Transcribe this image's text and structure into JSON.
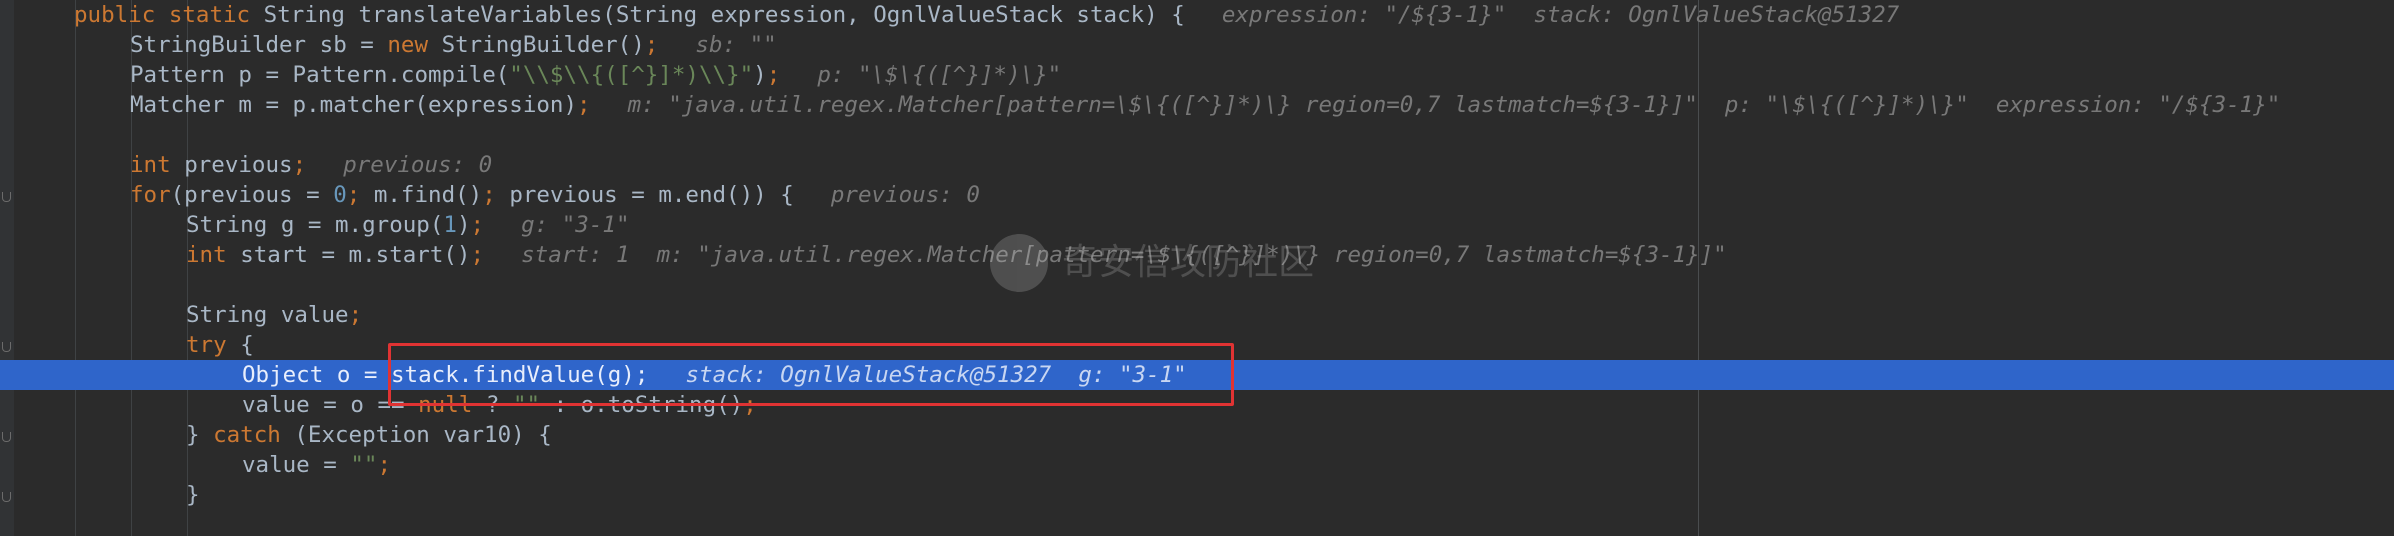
{
  "editor": {
    "lines": [
      {
        "indent": 1,
        "tokens": [
          {
            "t": "kw",
            "v": "public static "
          },
          {
            "t": "text",
            "v": "String translateVariables(String expression, OgnlValueStack stack) {"
          }
        ],
        "hint": "expression: \"/${3-1}\"  stack: OgnlValueStack@51327"
      },
      {
        "indent": 2,
        "tokens": [
          {
            "t": "text",
            "v": "StringBuilder sb = "
          },
          {
            "t": "kw",
            "v": "new "
          },
          {
            "t": "text",
            "v": "StringBuilder()"
          },
          {
            "t": "kw",
            "v": ";"
          }
        ],
        "hint": "sb: \"\""
      },
      {
        "indent": 2,
        "tokens": [
          {
            "t": "text",
            "v": "Pattern p = Pattern.compile("
          },
          {
            "t": "str",
            "v": "\"\\\\$\\\\{([^}]*)\\\\}\""
          },
          {
            "t": "text",
            "v": ")"
          },
          {
            "t": "kw",
            "v": ";"
          }
        ],
        "hint": "p: \"\\$\\{([^}]*)\\}\""
      },
      {
        "indent": 2,
        "tokens": [
          {
            "t": "text",
            "v": "Matcher m = p.matcher(expression)"
          },
          {
            "t": "kw",
            "v": ";"
          }
        ],
        "hint": "m: \"java.util.regex.Matcher[pattern=\\$\\{([^}]*)\\} region=0,7 lastmatch=${3-1}]\"  p: \"\\$\\{([^}]*)\\}\"  expression: \"/${3-1}\""
      },
      {
        "indent": 0,
        "tokens": [],
        "hint": ""
      },
      {
        "indent": 2,
        "tokens": [
          {
            "t": "kw",
            "v": "int "
          },
          {
            "t": "text",
            "v": "previous"
          },
          {
            "t": "kw",
            "v": ";"
          }
        ],
        "hint": "previous: 0"
      },
      {
        "indent": 2,
        "tokens": [
          {
            "t": "kw",
            "v": "for"
          },
          {
            "t": "text",
            "v": "(previous = "
          },
          {
            "t": "num",
            "v": "0"
          },
          {
            "t": "kw",
            "v": "; "
          },
          {
            "t": "text",
            "v": "m.find()"
          },
          {
            "t": "kw",
            "v": "; "
          },
          {
            "t": "text",
            "v": "previous = m.end()) {"
          }
        ],
        "hint": "previous: 0"
      },
      {
        "indent": 3,
        "tokens": [
          {
            "t": "text",
            "v": "String g = m.group("
          },
          {
            "t": "num",
            "v": "1"
          },
          {
            "t": "text",
            "v": ")"
          },
          {
            "t": "kw",
            "v": ";"
          }
        ],
        "hint": "g: \"3-1\""
      },
      {
        "indent": 3,
        "tokens": [
          {
            "t": "kw",
            "v": "int "
          },
          {
            "t": "text",
            "v": "start = m.start()"
          },
          {
            "t": "kw",
            "v": ";"
          }
        ],
        "hint": "start: 1  m: \"java.util.regex.Matcher[pattern=\\$\\{([^}]*)\\} region=0,7 lastmatch=${3-1}]\""
      },
      {
        "indent": 0,
        "tokens": [],
        "hint": ""
      },
      {
        "indent": 3,
        "tokens": [
          {
            "t": "text",
            "v": "String value"
          },
          {
            "t": "kw",
            "v": ";"
          }
        ],
        "hint": ""
      },
      {
        "indent": 3,
        "tokens": [
          {
            "t": "kw",
            "v": "try "
          },
          {
            "t": "text",
            "v": "{"
          }
        ],
        "hint": ""
      },
      {
        "indent": 4,
        "tokens": [
          {
            "t": "text",
            "v": "Object o = stack.findValue(g)"
          },
          {
            "t": "kw",
            "v": ";"
          }
        ],
        "hint": "stack: OgnlValueStack@51327  g: \"3-1\"",
        "current": true
      },
      {
        "indent": 4,
        "tokens": [
          {
            "t": "text",
            "v": "value = o == "
          },
          {
            "t": "kw",
            "v": "null "
          },
          {
            "t": "text",
            "v": "? "
          },
          {
            "t": "str",
            "v": "\"\" "
          },
          {
            "t": "text",
            "v": ": o.toString()"
          },
          {
            "t": "kw",
            "v": ";"
          }
        ],
        "hint": ""
      },
      {
        "indent": 3,
        "tokens": [
          {
            "t": "text",
            "v": "} "
          },
          {
            "t": "kw",
            "v": "catch "
          },
          {
            "t": "text",
            "v": "(Exception var10) {"
          }
        ],
        "hint": ""
      },
      {
        "indent": 4,
        "tokens": [
          {
            "t": "text",
            "v": "value = "
          },
          {
            "t": "str",
            "v": "\"\""
          },
          {
            "t": "kw",
            "v": ";"
          }
        ],
        "hint": ""
      },
      {
        "indent": 3,
        "tokens": [
          {
            "t": "text",
            "v": "}"
          }
        ],
        "hint": ""
      }
    ]
  },
  "watermark": {
    "text": "奇安信攻防社区"
  },
  "colors": {
    "background": "#2b2b2b",
    "keyword": "#cc7832",
    "string": "#6a8759",
    "number": "#6897bb",
    "text": "#a9b7c6",
    "hint": "#787878",
    "current_line": "#2f65ca",
    "annotation_box": "#e03333"
  }
}
